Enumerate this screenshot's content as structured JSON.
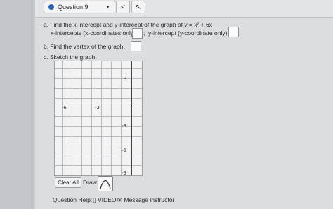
{
  "header": {
    "question_label": "Question 9",
    "dropdown_icon": "chevron-down-icon",
    "prev_icon": "chevron-left-icon",
    "next_icon": "chevron-right-icon"
  },
  "question": {
    "part_a": "a.  Find the x-intercept and y-intercept of the graph of y = x² + 6x",
    "x_int_label": "x-intercepts (x-coordinates only)",
    "separator": ";",
    "y_int_label": "y-intercept (y-coordinate only)",
    "part_b": "b.  Find the vertex of the graph.",
    "part_c": "c.  Sketch the graph."
  },
  "graph": {
    "x_ticks": [
      "-6",
      "-3"
    ],
    "y_ticks": [
      "3",
      "-3",
      "-6",
      "-9"
    ]
  },
  "controls": {
    "clear_all": "Clear All",
    "draw_label": "Draw:",
    "draw_tool_icon": "parabola-icon"
  },
  "help": {
    "label": "Question Help:",
    "video_label": "VIDEO",
    "message_label": "Message instructor",
    "video_icon": "document-icon",
    "message_icon": "envelope-icon"
  },
  "colors": {
    "accent": "#2a62b8",
    "background": "#dcdddf"
  }
}
